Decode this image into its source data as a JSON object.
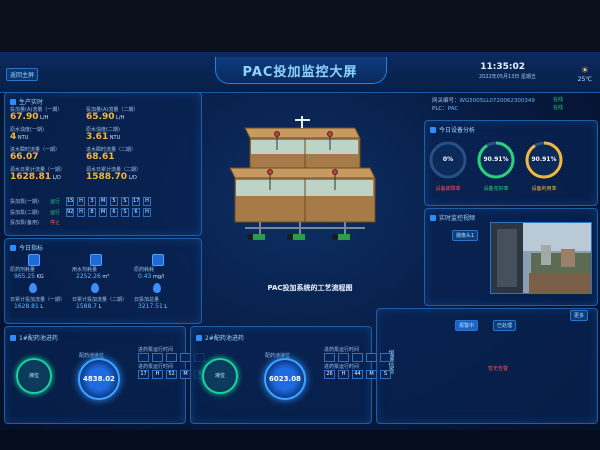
{
  "header": {
    "title": "PAC投加监控大屏",
    "back_label": "返回主屏",
    "time": "11:35:02",
    "date": "2022年05月13日 星期五",
    "weather_temp": "25℃"
  },
  "gateway": {
    "gateway_label": "网关编号：",
    "gateway_value": "WG5005LL0720062300349",
    "gateway_status": "在线",
    "plc_label": "PLC：",
    "plc_value": "PAC",
    "plc_status": "在线"
  },
  "production": {
    "title": "生产实时",
    "items": [
      {
        "label": "投加量(A)流量（一期）",
        "value": "67.90",
        "unit": "L/H"
      },
      {
        "label": "投加量(A)流量（二期）",
        "value": "65.90",
        "unit": "L/H"
      },
      {
        "label": "原水浊度(一期)",
        "value": "4",
        "unit": "NTU"
      },
      {
        "label": "原水浊度(二期)",
        "value": "3.61",
        "unit": "NTU"
      },
      {
        "label": "进水瞬时流量（一期）",
        "value": "66.07",
        "unit": ""
      },
      {
        "label": "进水瞬时流量（二期）",
        "value": "68.61",
        "unit": ""
      },
      {
        "label": "源水日累计流量（一期）",
        "value": "1628.81",
        "unit": "L/D"
      },
      {
        "label": "源水日累计流量（二期）",
        "value": "1588.70",
        "unit": "L/D"
      }
    ],
    "pump_rows": [
      {
        "label": "投加泵(一期)",
        "status": "运行",
        "digits": [
          "15",
          "H",
          "3",
          "M",
          "5",
          "S",
          "17",
          "H"
        ]
      },
      {
        "label": "投加泵(二期)",
        "status": "运行",
        "digits": [
          "92",
          "H",
          "8",
          "M",
          "6",
          "S",
          "6",
          "H"
        ]
      },
      {
        "label": "投加泵(备用)",
        "status": "停止",
        "digits": []
      }
    ]
  },
  "today": {
    "title": "今日指标",
    "stats": [
      {
        "label": "原药剂耗量",
        "value": "965.25",
        "unit": "KG"
      },
      {
        "label": "用水剂耗量",
        "value": "2252.26",
        "unit": "m³"
      },
      {
        "label": "原药耗耗",
        "value": "0.43",
        "unit": "mg/l"
      },
      {
        "label": "日累计投加流量（一期）",
        "value": "1628.81",
        "unit": "L"
      },
      {
        "label": "日累计投加流量（二期）",
        "value": "1588.7",
        "unit": "L"
      },
      {
        "label": "日投加总量",
        "value": "3217.51",
        "unit": "L"
      }
    ]
  },
  "device_analysis": {
    "title": "今日设备分析",
    "rings": [
      {
        "value": "0%",
        "label": "设备故障率",
        "color": "#ff4d4d",
        "fraction": 0.0
      },
      {
        "value": "90.91%",
        "label": "设备完好率",
        "color": "#28d17c",
        "fraction": 0.9091
      },
      {
        "value": "90.91%",
        "label": "设备利用率",
        "color": "#f5b73b",
        "fraction": 0.9091
      }
    ]
  },
  "video": {
    "title": "实时监控视频",
    "camera_label": "摄像头1"
  },
  "alarm": {
    "tabs": [
      "报警中",
      "已处理"
    ],
    "more_label": "更多",
    "side_label": "报警信息",
    "no_alarm_text": "暂无告警"
  },
  "dosing1": {
    "title": "1#配药池进药",
    "center_label": "液位",
    "value": "4838.02",
    "value_label": "配药池液位",
    "cells": [
      {
        "label": "进药泵运行时间",
        "digits": [
          "",
          "",
          "",
          "",
          ""
        ]
      },
      {
        "label": "进药泵运行时间",
        "digits": [
          "17",
          "H",
          "52",
          "M",
          "S"
        ]
      }
    ]
  },
  "dosing2": {
    "title": "2#配药池进药",
    "center_label": "液位",
    "value": "6023.08",
    "value_label": "配药池液位",
    "cells": [
      {
        "label": "进药泵运行时间",
        "digits": [
          "",
          "",
          "",
          "",
          ""
        ]
      },
      {
        "label": "进药泵运行时间",
        "digits": [
          "26",
          "H",
          "44",
          "M",
          "S"
        ]
      }
    ]
  },
  "process": {
    "caption": "PAC投加系统的工艺流程图"
  }
}
